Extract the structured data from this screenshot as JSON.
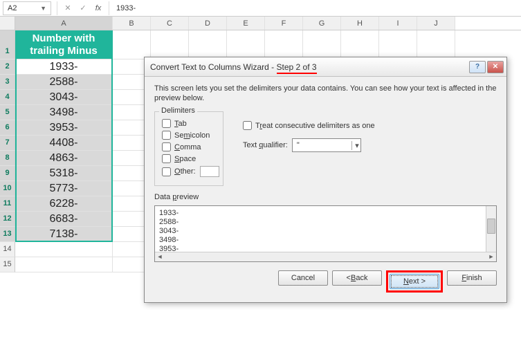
{
  "formula_bar": {
    "name_box": "A2",
    "value": "1933-",
    "fx": "fx",
    "cancel": "✕",
    "confirm": "✓"
  },
  "columns": [
    "A",
    "B",
    "C",
    "D",
    "E",
    "F",
    "G",
    "H",
    "I",
    "J"
  ],
  "header_cell": {
    "line1": "Number with",
    "line2": "trailing Minus"
  },
  "data": [
    "1933-",
    "2588-",
    "3043-",
    "3498-",
    "3953-",
    "4408-",
    "4863-",
    "5318-",
    "5773-",
    "6228-",
    "6683-",
    "7138-"
  ],
  "extra_rows": [
    "14",
    "15"
  ],
  "dialog": {
    "title_prefix": "Convert Text to Columns Wizard - ",
    "title_step": "Step 2 of 3",
    "desc": "This screen lets you set the delimiters your data contains.  You can see how your text is affected in the preview below.",
    "delimiters_label": "Delimiters",
    "delims": {
      "tab": "Tab",
      "semicolon": "Semicolon",
      "comma": "Comma",
      "space": "Space",
      "other": "Other:"
    },
    "treat_consecutive": "Treat consecutive delimiters as one",
    "qualifier_label": "Text qualifier:",
    "qualifier_value": "\"",
    "preview_label": "Data preview",
    "preview_lines": [
      "1933-",
      "2588-",
      "3043-",
      "3498-",
      "3953-"
    ],
    "buttons": {
      "cancel": "Cancel",
      "back": "< Back",
      "next": "Next >",
      "finish": "Finish"
    },
    "help": "?",
    "close": "✕"
  }
}
